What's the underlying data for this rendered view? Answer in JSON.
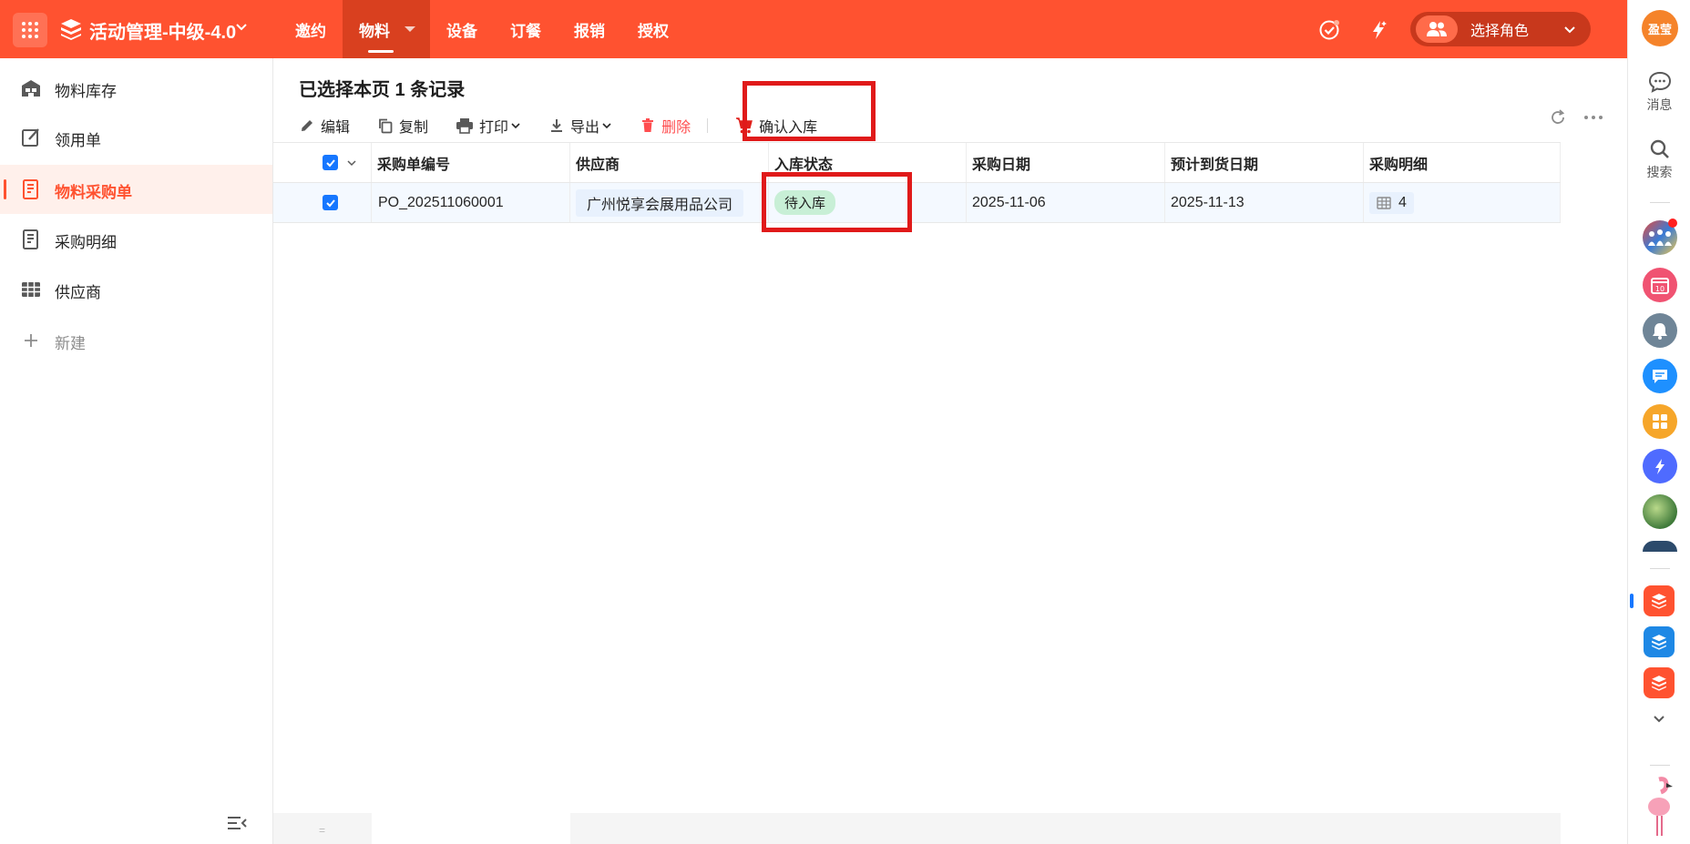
{
  "header": {
    "app_name": "活动管理-中级-4.0",
    "nav": [
      "邀约",
      "物料",
      "设备",
      "订餐",
      "报销",
      "授权"
    ],
    "active_nav": "物料",
    "role_label": "选择角色"
  },
  "right_rail": {
    "user_badge": "盈莹",
    "messages_label": "消息",
    "search_label": "搜索",
    "calendar_day": "10"
  },
  "sidebar": {
    "items": [
      {
        "label": "物料库存",
        "icon": "warehouse-icon"
      },
      {
        "label": "领用单",
        "icon": "edit-form-icon"
      },
      {
        "label": "物料采购单",
        "icon": "receipt-icon"
      },
      {
        "label": "采购明细",
        "icon": "receipt-detail-icon"
      },
      {
        "label": "供应商",
        "icon": "table-grid-icon"
      }
    ],
    "active": "物料采购单",
    "new_label": "新建"
  },
  "main": {
    "selection_title": "已选择本页 1 条记录",
    "toolbar": {
      "edit": "编辑",
      "copy": "复制",
      "print": "打印",
      "export": "导出",
      "delete": "删除",
      "confirm_stock_in": "确认入库"
    },
    "table": {
      "columns": [
        "采购单编号",
        "供应商",
        "入库状态",
        "采购日期",
        "预计到货日期",
        "采购明细"
      ],
      "rows": [
        {
          "po_number": "PO_202511060001",
          "supplier": "广州悦享会展用品公司",
          "status": "待入库",
          "purchase_date": "2025-11-06",
          "expected_date": "2025-11-13",
          "detail_count": "4"
        }
      ]
    },
    "scroll_grip": "="
  },
  "colors": {
    "brand": "#ff5230",
    "highlight_box": "#e01a1a",
    "checkbox": "#1677ff",
    "status_tag": "#c8efd6"
  }
}
